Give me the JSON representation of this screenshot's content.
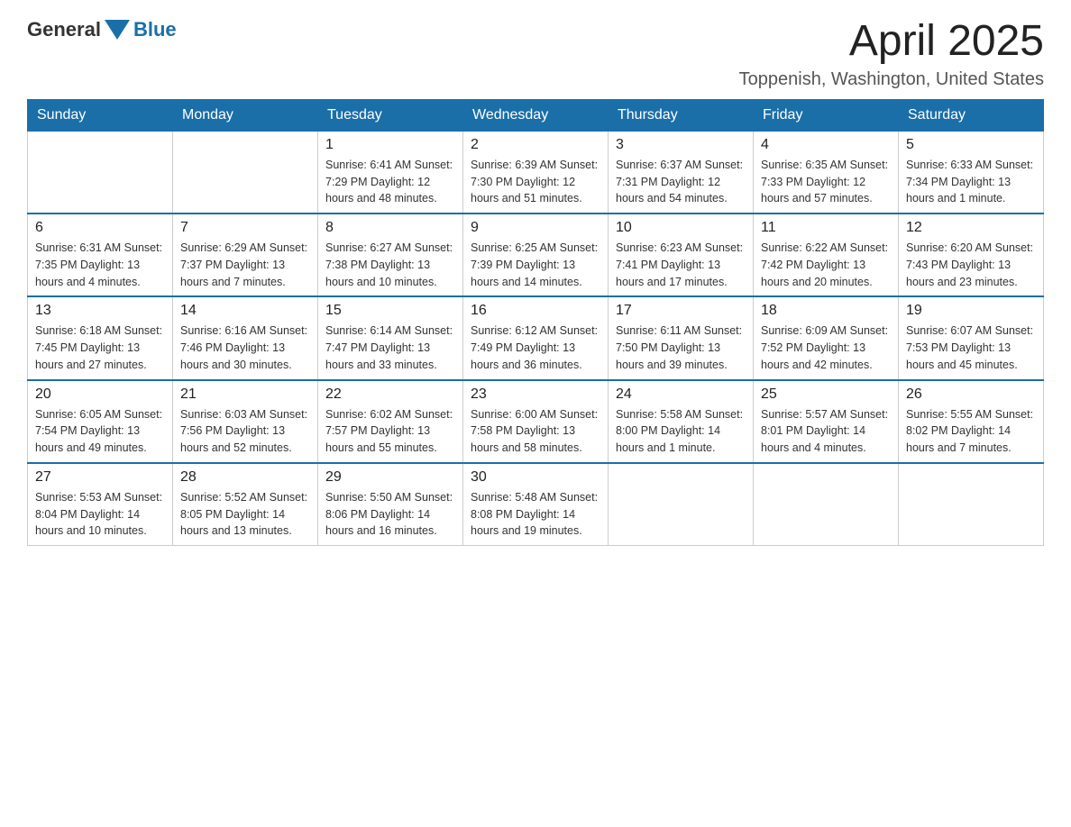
{
  "header": {
    "logo": {
      "text_general": "General",
      "text_blue": "Blue"
    },
    "title": "April 2025",
    "location": "Toppenish, Washington, United States"
  },
  "days_of_week": [
    "Sunday",
    "Monday",
    "Tuesday",
    "Wednesday",
    "Thursday",
    "Friday",
    "Saturday"
  ],
  "weeks": [
    [
      {
        "day": "",
        "info": ""
      },
      {
        "day": "",
        "info": ""
      },
      {
        "day": "1",
        "info": "Sunrise: 6:41 AM\nSunset: 7:29 PM\nDaylight: 12 hours\nand 48 minutes."
      },
      {
        "day": "2",
        "info": "Sunrise: 6:39 AM\nSunset: 7:30 PM\nDaylight: 12 hours\nand 51 minutes."
      },
      {
        "day": "3",
        "info": "Sunrise: 6:37 AM\nSunset: 7:31 PM\nDaylight: 12 hours\nand 54 minutes."
      },
      {
        "day": "4",
        "info": "Sunrise: 6:35 AM\nSunset: 7:33 PM\nDaylight: 12 hours\nand 57 minutes."
      },
      {
        "day": "5",
        "info": "Sunrise: 6:33 AM\nSunset: 7:34 PM\nDaylight: 13 hours\nand 1 minute."
      }
    ],
    [
      {
        "day": "6",
        "info": "Sunrise: 6:31 AM\nSunset: 7:35 PM\nDaylight: 13 hours\nand 4 minutes."
      },
      {
        "day": "7",
        "info": "Sunrise: 6:29 AM\nSunset: 7:37 PM\nDaylight: 13 hours\nand 7 minutes."
      },
      {
        "day": "8",
        "info": "Sunrise: 6:27 AM\nSunset: 7:38 PM\nDaylight: 13 hours\nand 10 minutes."
      },
      {
        "day": "9",
        "info": "Sunrise: 6:25 AM\nSunset: 7:39 PM\nDaylight: 13 hours\nand 14 minutes."
      },
      {
        "day": "10",
        "info": "Sunrise: 6:23 AM\nSunset: 7:41 PM\nDaylight: 13 hours\nand 17 minutes."
      },
      {
        "day": "11",
        "info": "Sunrise: 6:22 AM\nSunset: 7:42 PM\nDaylight: 13 hours\nand 20 minutes."
      },
      {
        "day": "12",
        "info": "Sunrise: 6:20 AM\nSunset: 7:43 PM\nDaylight: 13 hours\nand 23 minutes."
      }
    ],
    [
      {
        "day": "13",
        "info": "Sunrise: 6:18 AM\nSunset: 7:45 PM\nDaylight: 13 hours\nand 27 minutes."
      },
      {
        "day": "14",
        "info": "Sunrise: 6:16 AM\nSunset: 7:46 PM\nDaylight: 13 hours\nand 30 minutes."
      },
      {
        "day": "15",
        "info": "Sunrise: 6:14 AM\nSunset: 7:47 PM\nDaylight: 13 hours\nand 33 minutes."
      },
      {
        "day": "16",
        "info": "Sunrise: 6:12 AM\nSunset: 7:49 PM\nDaylight: 13 hours\nand 36 minutes."
      },
      {
        "day": "17",
        "info": "Sunrise: 6:11 AM\nSunset: 7:50 PM\nDaylight: 13 hours\nand 39 minutes."
      },
      {
        "day": "18",
        "info": "Sunrise: 6:09 AM\nSunset: 7:52 PM\nDaylight: 13 hours\nand 42 minutes."
      },
      {
        "day": "19",
        "info": "Sunrise: 6:07 AM\nSunset: 7:53 PM\nDaylight: 13 hours\nand 45 minutes."
      }
    ],
    [
      {
        "day": "20",
        "info": "Sunrise: 6:05 AM\nSunset: 7:54 PM\nDaylight: 13 hours\nand 49 minutes."
      },
      {
        "day": "21",
        "info": "Sunrise: 6:03 AM\nSunset: 7:56 PM\nDaylight: 13 hours\nand 52 minutes."
      },
      {
        "day": "22",
        "info": "Sunrise: 6:02 AM\nSunset: 7:57 PM\nDaylight: 13 hours\nand 55 minutes."
      },
      {
        "day": "23",
        "info": "Sunrise: 6:00 AM\nSunset: 7:58 PM\nDaylight: 13 hours\nand 58 minutes."
      },
      {
        "day": "24",
        "info": "Sunrise: 5:58 AM\nSunset: 8:00 PM\nDaylight: 14 hours\nand 1 minute."
      },
      {
        "day": "25",
        "info": "Sunrise: 5:57 AM\nSunset: 8:01 PM\nDaylight: 14 hours\nand 4 minutes."
      },
      {
        "day": "26",
        "info": "Sunrise: 5:55 AM\nSunset: 8:02 PM\nDaylight: 14 hours\nand 7 minutes."
      }
    ],
    [
      {
        "day": "27",
        "info": "Sunrise: 5:53 AM\nSunset: 8:04 PM\nDaylight: 14 hours\nand 10 minutes."
      },
      {
        "day": "28",
        "info": "Sunrise: 5:52 AM\nSunset: 8:05 PM\nDaylight: 14 hours\nand 13 minutes."
      },
      {
        "day": "29",
        "info": "Sunrise: 5:50 AM\nSunset: 8:06 PM\nDaylight: 14 hours\nand 16 minutes."
      },
      {
        "day": "30",
        "info": "Sunrise: 5:48 AM\nSunset: 8:08 PM\nDaylight: 14 hours\nand 19 minutes."
      },
      {
        "day": "",
        "info": ""
      },
      {
        "day": "",
        "info": ""
      },
      {
        "day": "",
        "info": ""
      }
    ]
  ]
}
